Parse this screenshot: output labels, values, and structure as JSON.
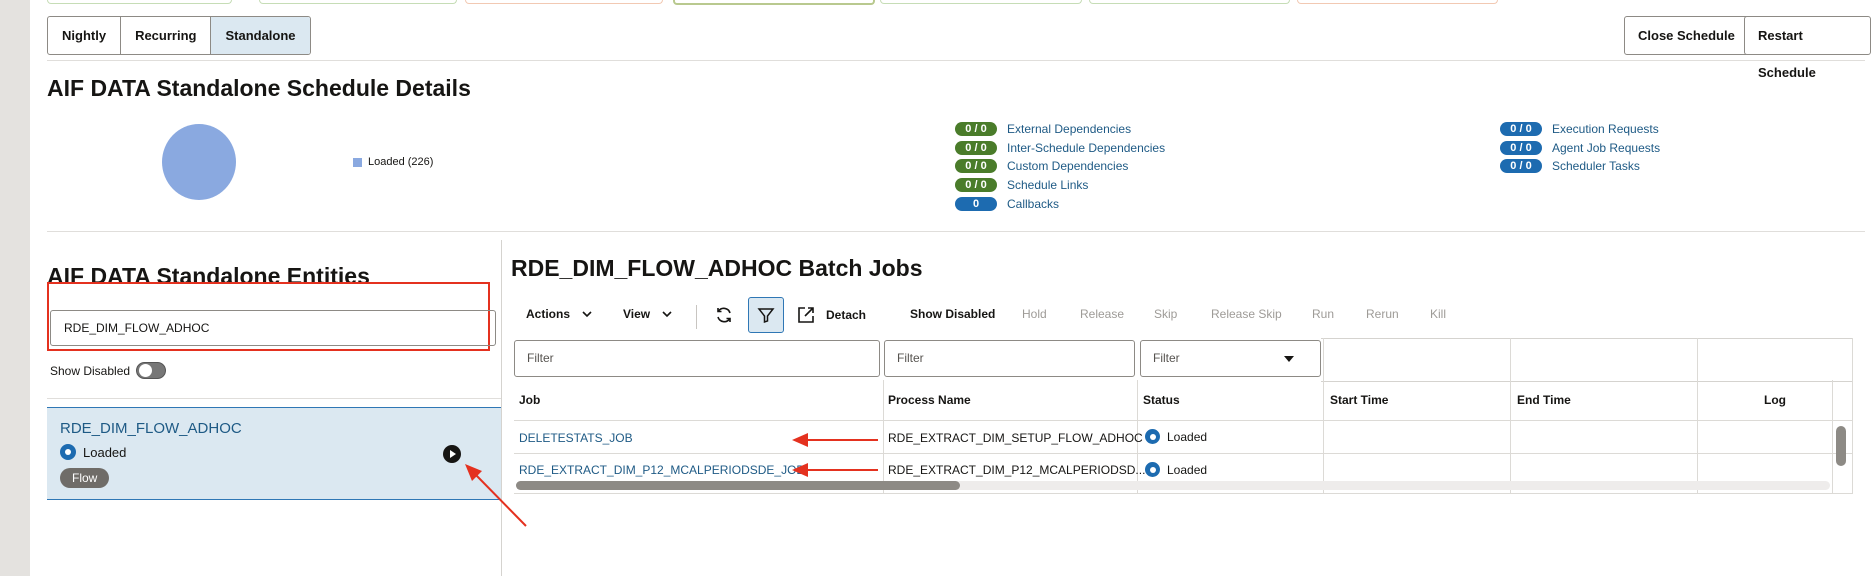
{
  "schedule_tabs": [
    "Nightly",
    "Recurring",
    "Standalone"
  ],
  "top_actions": {
    "close": "Close Schedule",
    "restart": "Restart Schedule"
  },
  "summary": {
    "title": "AIF DATA Standalone Schedule Details",
    "pie_legend": "Loaded (226)",
    "color_loaded": "#8aa9e0",
    "dependencies": [
      {
        "count": "0 / 0",
        "label": "External Dependencies"
      },
      {
        "count": "0 / 0",
        "label": "Inter-Schedule Dependencies"
      },
      {
        "count": "0 / 0",
        "label": "Custom Dependencies"
      },
      {
        "count": "0 / 0",
        "label": "Schedule Links"
      },
      {
        "count": "0",
        "label": "Callbacks"
      }
    ],
    "requests": [
      {
        "count": "0 / 0",
        "label": "Execution Requests"
      },
      {
        "count": "0 / 0",
        "label": "Agent Job Requests"
      },
      {
        "count": "0 / 0",
        "label": "Scheduler Tasks"
      }
    ]
  },
  "entities": {
    "title": "AIF DATA Standalone Entities",
    "search_value": "RDE_DIM_FLOW_ADHOC",
    "show_disabled_label": "Show Disabled",
    "item": {
      "name": "RDE_DIM_FLOW_ADHOC",
      "status": "Loaded",
      "type": "Flow"
    }
  },
  "jobs": {
    "title": "RDE_DIM_FLOW_ADHOC Batch Jobs",
    "toolbar": {
      "actions": "Actions",
      "view": "View",
      "detach": "Detach",
      "show_disabled": "Show Disabled",
      "hold": "Hold",
      "release": "Release",
      "skip": "Skip",
      "release_skip": "Release Skip",
      "run": "Run",
      "rerun": "Rerun",
      "kill": "Kill"
    },
    "filter_placeholder": "Filter",
    "columns": [
      "Job",
      "Process Name",
      "Status",
      "Start Time",
      "End Time",
      "Log"
    ],
    "rows": [
      {
        "job": "DELETESTATS_JOB",
        "process": "RDE_EXTRACT_DIM_SETUP_FLOW_ADHOC",
        "status": "Loaded",
        "start": "",
        "end": "",
        "log": ""
      },
      {
        "job": "RDE_EXTRACT_DIM_P12_MCALPERIODSDE_JOB",
        "process": "RDE_EXTRACT_DIM_P12_MCALPERIODSD...",
        "status": "Loaded",
        "start": "",
        "end": "",
        "log": ""
      }
    ]
  },
  "annotation_color": "#e4311f"
}
